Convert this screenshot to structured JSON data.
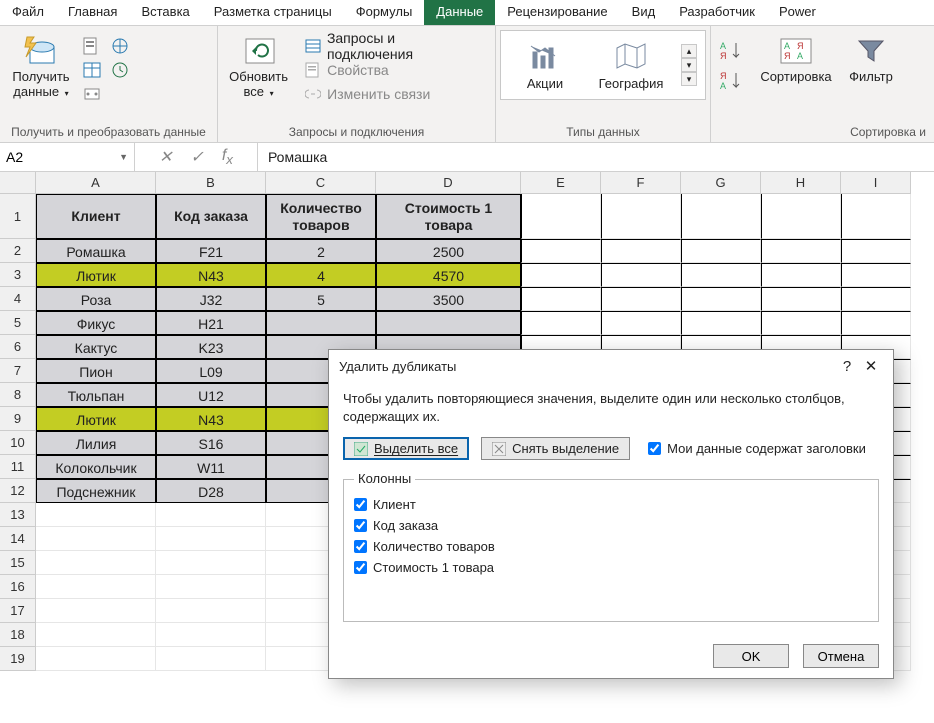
{
  "tabs": [
    "Файл",
    "Главная",
    "Вставка",
    "Разметка страницы",
    "Формулы",
    "Данные",
    "Рецензирование",
    "Вид",
    "Разработчик",
    "Power"
  ],
  "active_tab_index": 5,
  "ribbon": {
    "g1": {
      "label": "Получить и преобразовать данные",
      "get_data": "Получить данные"
    },
    "g2": {
      "label": "Запросы и подключения",
      "refresh": "Обновить все",
      "items": [
        "Запросы и подключения",
        "Свойства",
        "Изменить связи"
      ]
    },
    "g3": {
      "label": "Типы данных",
      "stock": "Акции",
      "geo": "География"
    },
    "g4": {
      "label": "Сортировка и",
      "sort": "Сортировка",
      "filter": "Фильтр"
    }
  },
  "namebox": "A2",
  "formula": "Ромашка",
  "columns": [
    "A",
    "B",
    "C",
    "D",
    "E",
    "F",
    "G",
    "H",
    "I"
  ],
  "headers": [
    "Клиент",
    "Код заказа",
    "Количество товаров",
    "Стоимость 1 товара"
  ],
  "rows": [
    {
      "n": 2,
      "hl": false,
      "c": [
        "Ромашка",
        "F21",
        "2",
        "2500"
      ]
    },
    {
      "n": 3,
      "hl": true,
      "c": [
        "Лютик",
        "N43",
        "4",
        "4570"
      ]
    },
    {
      "n": 4,
      "hl": false,
      "c": [
        "Роза",
        "J32",
        "5",
        "3500"
      ]
    },
    {
      "n": 5,
      "hl": false,
      "c": [
        "Фикус",
        "H21",
        "",
        ""
      ]
    },
    {
      "n": 6,
      "hl": false,
      "c": [
        "Кактус",
        "K23",
        "",
        ""
      ]
    },
    {
      "n": 7,
      "hl": false,
      "c": [
        "Пион",
        "L09",
        "",
        ""
      ]
    },
    {
      "n": 8,
      "hl": false,
      "c": [
        "Тюльпан",
        "U12",
        "",
        ""
      ]
    },
    {
      "n": 9,
      "hl": true,
      "c": [
        "Лютик",
        "N43",
        "",
        ""
      ]
    },
    {
      "n": 10,
      "hl": false,
      "c": [
        "Лилия",
        "S16",
        "",
        ""
      ]
    },
    {
      "n": 11,
      "hl": false,
      "c": [
        "Колокольчик",
        "W11",
        "",
        ""
      ]
    },
    {
      "n": 12,
      "hl": false,
      "c": [
        "Подснежник",
        "D28",
        "",
        ""
      ]
    }
  ],
  "empty_rows": [
    13,
    14,
    15,
    16,
    17,
    18,
    19
  ],
  "dialog": {
    "title": "Удалить дубликаты",
    "help": "?",
    "close": "✕",
    "msg": "Чтобы удалить повторяющиеся значения, выделите один или несколько столбцов, содержащих их.",
    "select_all": "Выделить все",
    "deselect": "Снять выделение",
    "has_headers": "Мои данные содержат заголовки",
    "legend": "Колонны",
    "columns": [
      "Клиент",
      "Код заказа",
      "Количество товаров",
      "Стоимость 1 товара"
    ],
    "ok": "OK",
    "cancel": "Отмена"
  }
}
